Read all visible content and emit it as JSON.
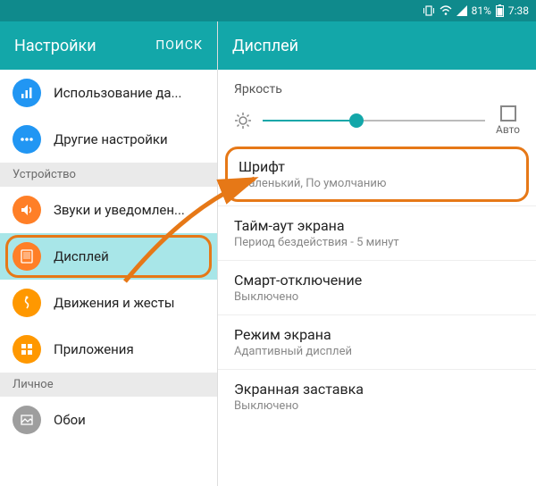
{
  "statusbar": {
    "battery_pct": "81%",
    "time": "7:38"
  },
  "left_header": {
    "title": "Настройки",
    "search": "ПОИСК"
  },
  "right_header": {
    "title": "Дисплей"
  },
  "sidebar": {
    "items": [
      {
        "label": "Использование да...",
        "color": "c-blue"
      },
      {
        "label": "Другие настройки",
        "color": "c-blue"
      }
    ],
    "section_device": "Устройство",
    "device_items": [
      {
        "label": "Звуки и уведомлен...",
        "color": "c-orange"
      },
      {
        "label": "Дисплей",
        "color": "c-orange",
        "selected": true
      },
      {
        "label": "Движения и жесты",
        "color": "c-orange2"
      },
      {
        "label": "Приложения",
        "color": "c-orange2"
      }
    ],
    "section_personal": "Личное",
    "personal_items": [
      {
        "label": "Обои",
        "color": "c-grey"
      }
    ]
  },
  "brightness": {
    "label": "Яркость",
    "auto": "Авто"
  },
  "settings": [
    {
      "title": "Шрифт",
      "sub": "Маленький, По умолчанию",
      "highlight": true
    },
    {
      "title": "Тайм-аут экрана",
      "sub": "Период бездействия - 5 минут"
    },
    {
      "title": "Смарт-отключение",
      "sub": "Выключено"
    },
    {
      "title": "Режим экрана",
      "sub": "Адаптивный дисплей"
    },
    {
      "title": "Экранная заставка",
      "sub": "Выключено"
    }
  ]
}
